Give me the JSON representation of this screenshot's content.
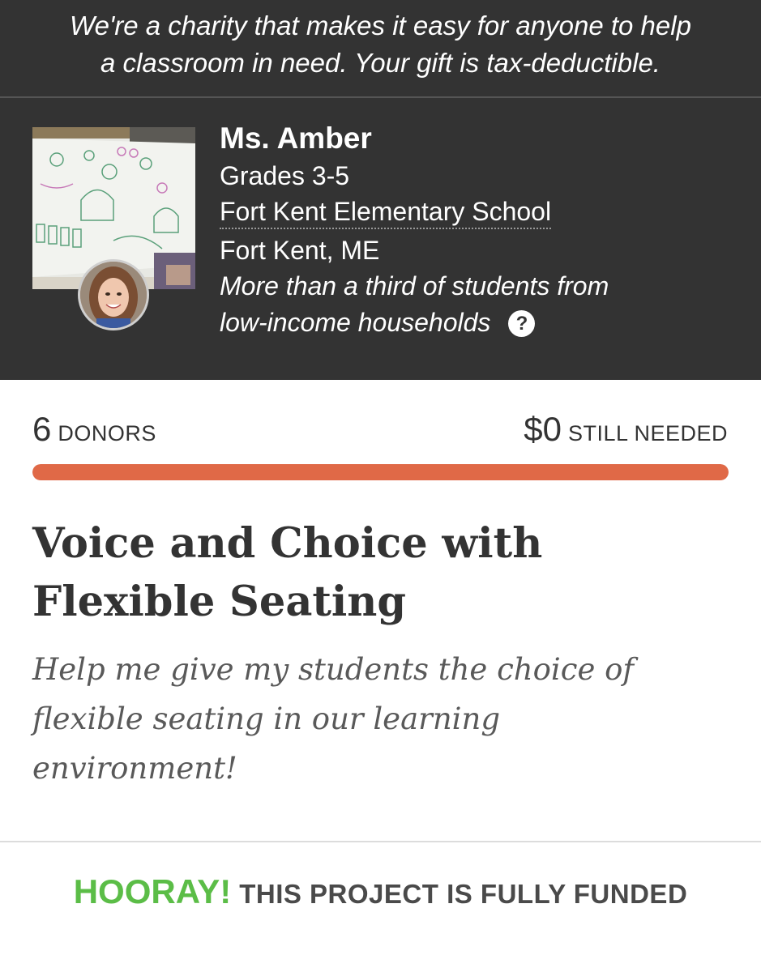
{
  "banner": {
    "line1": "We're a charity that makes it easy for anyone to help",
    "line2": "a classroom in need. Your gift is tax-deductible."
  },
  "teacher": {
    "name": "Ms. Amber",
    "grades": "Grades 3-5",
    "school": "Fort Kent Elementary School",
    "location": "Fort Kent, ME",
    "poverty_line1": "More than a third of students from",
    "poverty_line2": "low-income households",
    "help_icon": "question-circle-icon"
  },
  "stats": {
    "donors_count": "6",
    "donors_label": "DONORS",
    "still_needed_amount": "$0",
    "still_needed_label": "STILL NEEDED",
    "progress_fraction": 1.0
  },
  "project": {
    "title_line1": "Voice and Choice with",
    "title_line2": "Flexible Seating",
    "subtitle_line1": "Help me give my students the choice of",
    "subtitle_line2": "flexible seating in our learning",
    "subtitle_line3": "environment!"
  },
  "footer": {
    "hooray": "HOORAY!",
    "message": "THIS PROJECT IS FULLY FUNDED"
  },
  "colors": {
    "panel_bg": "#333333",
    "progress": "#e06947",
    "hooray": "#5bbd47"
  }
}
